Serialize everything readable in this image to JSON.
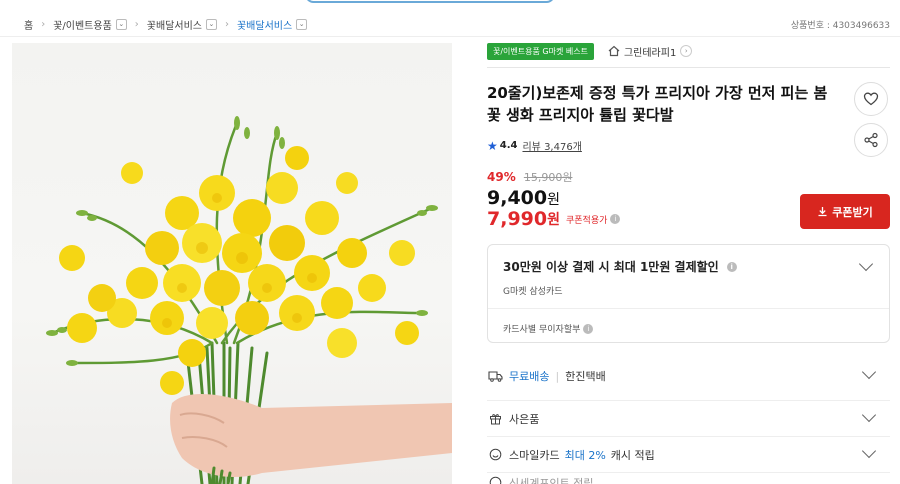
{
  "breadcrumb": {
    "items": [
      {
        "label": "홈"
      },
      {
        "label": "꽃/이벤트용품"
      },
      {
        "label": "꽃배달서비스"
      },
      {
        "label": "꽃배달서비스"
      }
    ]
  },
  "product_number": "상품번호 : 4303496633",
  "badges": {
    "category_badge": "꽃/이벤트용품 G마켓 베스트",
    "store_name": "그린테라피1"
  },
  "product": {
    "title": "20줄기)보존제 증정 특가 프리지아 가장 먼저 피는 봄꽃 생화 프리지아 튤립 꽃다발",
    "rating": "4.4",
    "review_label": "리뷰 3,476개",
    "discount_pct": "49%",
    "original_price": "15,900원",
    "price_num": "9,400",
    "price_unit": "원",
    "coupon_price_num": "7,990",
    "coupon_price_unit": "원",
    "coupon_note": "쿠폰적용가",
    "coupon_button": "쿠폰받기"
  },
  "payment_card": {
    "headline": "30만원 이상 결제 시 최대 1만원 결제할인",
    "card_name": "G마켓 삼성카드",
    "installment": "카드사별 무이자할부"
  },
  "rows": {
    "shipping_free": "무료배송",
    "shipping_company": "한진택배",
    "gift": "사은품",
    "smile_prefix": "스마일카드",
    "smile_highlight": "최대 2%",
    "smile_suffix": "캐시 적립",
    "partial": "신세계포인트 적립"
  },
  "colors": {
    "accent_red": "#d8261f",
    "price_red": "#e0282b",
    "badge_green": "#2aa43a",
    "link_blue": "#1a73c9",
    "star_blue": "#1f5fd6",
    "freesia_yellow": "#f5d614"
  }
}
